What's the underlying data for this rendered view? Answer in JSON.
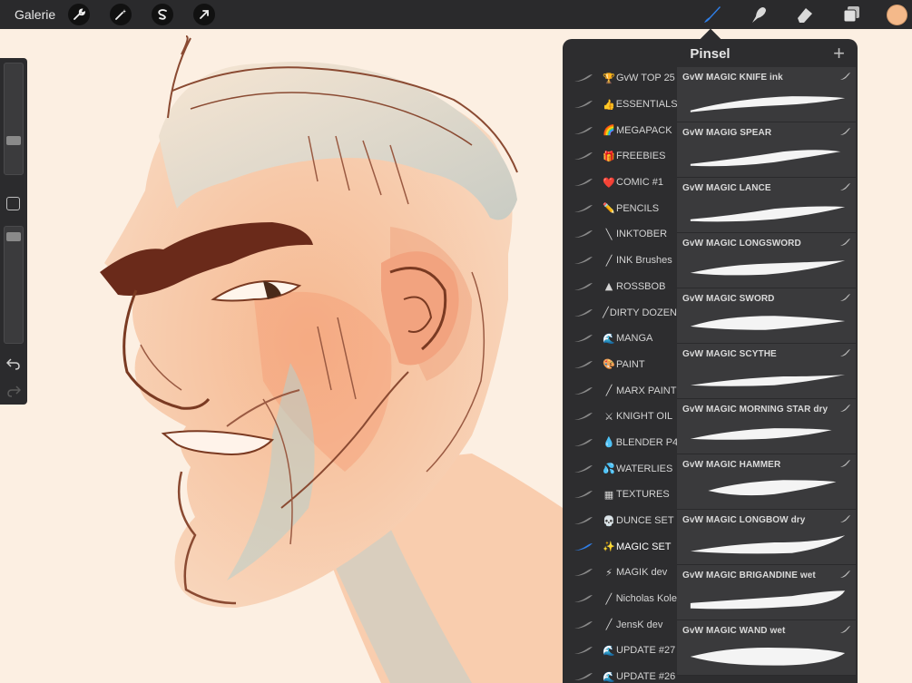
{
  "topbar": {
    "gallery_label": "Galerie",
    "tools": [
      "wrench-icon",
      "magic-wand-icon",
      "selection-icon",
      "transform-icon"
    ],
    "right_tools": [
      "brush-icon",
      "smudge-icon",
      "eraser-icon",
      "layers-icon"
    ],
    "active_tool": "brush-icon",
    "color": "#f4b98a"
  },
  "panel": {
    "title": "Pinsel",
    "add_label": "+",
    "sets": [
      {
        "emoji": "🏆",
        "label": "GvW TOP 25"
      },
      {
        "emoji": "👍",
        "label": "ESSENTIALS"
      },
      {
        "emoji": "🌈",
        "label": "MEGAPACK"
      },
      {
        "emoji": "🎁",
        "label": "FREEBIES"
      },
      {
        "emoji": "❤️",
        "label": "COMIC #1"
      },
      {
        "emoji": "✏️",
        "label": "PENCILS"
      },
      {
        "emoji": "╲",
        "label": "INKTOBER"
      },
      {
        "emoji": "╱",
        "label": "INK Brushes"
      },
      {
        "emoji": "▲",
        "label": "ROSSBOB"
      },
      {
        "emoji": "╱",
        "label": "DIRTY DOZEN"
      },
      {
        "emoji": "🌊",
        "label": "MANGA"
      },
      {
        "emoji": "🎨",
        "label": "PAINT"
      },
      {
        "emoji": "╱",
        "label": "MARX PAINT"
      },
      {
        "emoji": "⚔",
        "label": "KNIGHT OIL"
      },
      {
        "emoji": "💧",
        "label": "BLENDER P4"
      },
      {
        "emoji": "💦",
        "label": "WATERLIES"
      },
      {
        "emoji": "▦",
        "label": "TEXTURES"
      },
      {
        "emoji": "💀",
        "label": "DUNCE SET"
      },
      {
        "emoji": "✨",
        "label": "MAGIC SET"
      },
      {
        "emoji": "⚡",
        "label": "MAGIK dev"
      },
      {
        "emoji": "╱",
        "label": "Nicholas Kole"
      },
      {
        "emoji": "╱",
        "label": "JensK dev"
      },
      {
        "emoji": "🌊",
        "label": "UPDATE #27"
      },
      {
        "emoji": "🌊",
        "label": "UPDATE #26"
      }
    ],
    "active_set": "MAGIC SET",
    "brushes": [
      {
        "name": "GvW MAGIC KNIFE ink"
      },
      {
        "name": "GvW MAGIG SPEAR"
      },
      {
        "name": "GvW MAGIC LANCE"
      },
      {
        "name": "GvW MAGIC LONGSWORD"
      },
      {
        "name": "GvW MAGIC SWORD"
      },
      {
        "name": "GvW MAGIC SCYTHE"
      },
      {
        "name": "GvW MAGIC MORNING STAR dry"
      },
      {
        "name": "GvW MAGIC HAMMER"
      },
      {
        "name": "GvW MAGIC LONGBOW dry"
      },
      {
        "name": "GvW MAGIC BRIGANDINE wet"
      },
      {
        "name": "GvW MAGIC WAND wet"
      }
    ]
  }
}
